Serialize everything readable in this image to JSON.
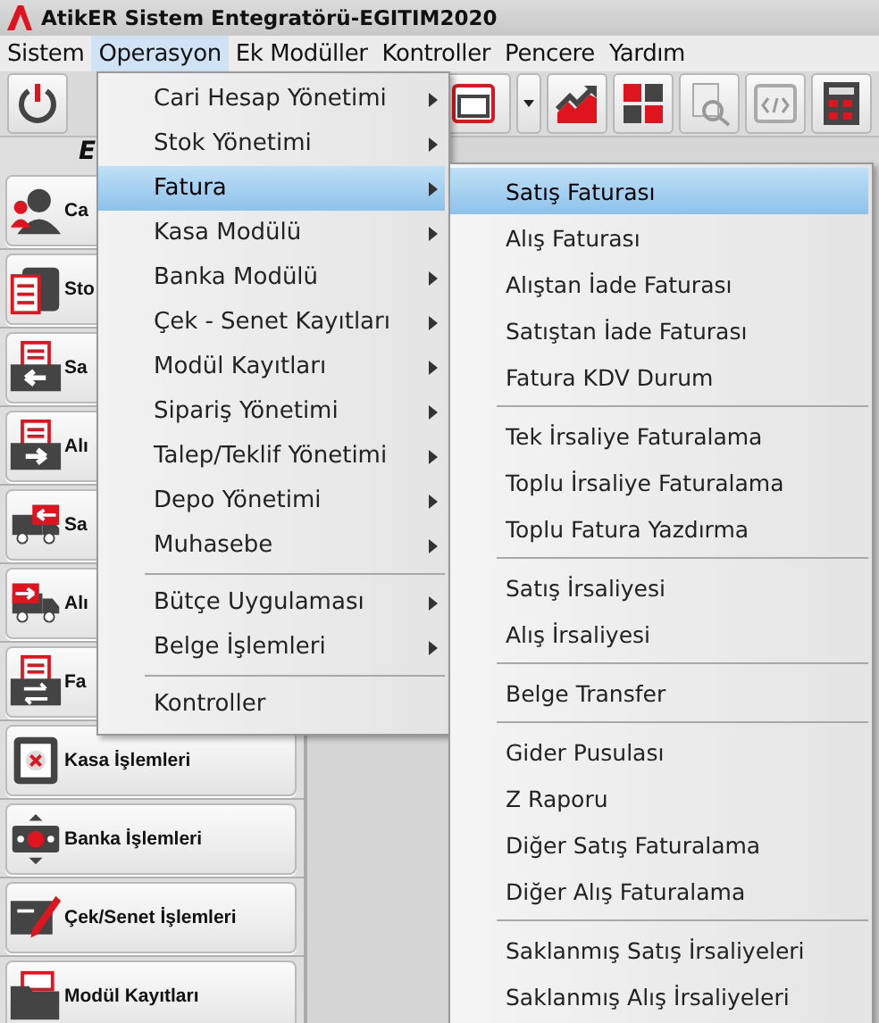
{
  "window": {
    "title": "AtikER Sistem Entegratörü-EGITIM2020"
  },
  "menubar": [
    {
      "label": "Sistem",
      "selected": false
    },
    {
      "label": "Operasyon",
      "selected": true
    },
    {
      "label": "Ek Modüller",
      "selected": false
    },
    {
      "label": "Kontroller",
      "selected": false
    },
    {
      "label": "Pencere",
      "selected": false
    },
    {
      "label": "Yardım",
      "selected": false
    }
  ],
  "toolbar_caption": "E",
  "sidebar_buttons": [
    {
      "label": "Ca"
    },
    {
      "label": "Sto"
    },
    {
      "label": "Sa"
    },
    {
      "label": "Alı"
    },
    {
      "label": "Sa"
    },
    {
      "label": "Alı"
    },
    {
      "label": "Fa"
    },
    {
      "label": "Kasa İşlemleri"
    },
    {
      "label": "Banka İşlemleri"
    },
    {
      "label": "Çek/Senet İşlemleri"
    },
    {
      "label": "Modül Kayıtları"
    }
  ],
  "menu": [
    {
      "kind": "item",
      "label": "Cari Hesap Yönetimi",
      "submenu": true,
      "selected": false
    },
    {
      "kind": "item",
      "label": "Stok Yönetimi",
      "submenu": true,
      "selected": false
    },
    {
      "kind": "item",
      "label": "Fatura",
      "submenu": true,
      "selected": true
    },
    {
      "kind": "item",
      "label": "Kasa Modülü",
      "submenu": true,
      "selected": false
    },
    {
      "kind": "item",
      "label": "Banka Modülü",
      "submenu": true,
      "selected": false
    },
    {
      "kind": "item",
      "label": "Çek - Senet Kayıtları",
      "submenu": true,
      "selected": false
    },
    {
      "kind": "item",
      "label": "Modül Kayıtları",
      "submenu": true,
      "selected": false
    },
    {
      "kind": "item",
      "label": "Sipariş Yönetimi",
      "submenu": true,
      "selected": false
    },
    {
      "kind": "item",
      "label": "Talep/Teklif Yönetimi",
      "submenu": true,
      "selected": false
    },
    {
      "kind": "item",
      "label": "Depo Yönetimi",
      "submenu": true,
      "selected": false
    },
    {
      "kind": "item",
      "label": "Muhasebe",
      "submenu": true,
      "selected": false
    },
    {
      "kind": "separator"
    },
    {
      "kind": "item",
      "label": "Bütçe Uygulaması",
      "submenu": true,
      "selected": false
    },
    {
      "kind": "item",
      "label": "Belge İşlemleri",
      "submenu": true,
      "selected": false
    },
    {
      "kind": "separator"
    },
    {
      "kind": "item",
      "label": "Kontroller",
      "submenu": false,
      "selected": false
    }
  ],
  "submenu": [
    {
      "kind": "item",
      "label": "Satış Faturası",
      "selected": true
    },
    {
      "kind": "item",
      "label": "Alış Faturası",
      "selected": false
    },
    {
      "kind": "item",
      "label": "Alıştan İade Faturası",
      "selected": false
    },
    {
      "kind": "item",
      "label": "Satıştan İade Faturası",
      "selected": false
    },
    {
      "kind": "item",
      "label": "Fatura KDV Durum",
      "selected": false
    },
    {
      "kind": "separator"
    },
    {
      "kind": "item",
      "label": "Tek İrsaliye Faturalama",
      "selected": false
    },
    {
      "kind": "item",
      "label": "Toplu İrsaliye Faturalama",
      "selected": false
    },
    {
      "kind": "item",
      "label": "Toplu Fatura Yazdırma",
      "selected": false
    },
    {
      "kind": "separator"
    },
    {
      "kind": "item",
      "label": "Satış İrsaliyesi",
      "selected": false
    },
    {
      "kind": "item",
      "label": "Alış İrsaliyesi",
      "selected": false
    },
    {
      "kind": "separator"
    },
    {
      "kind": "item",
      "label": "Belge Transfer",
      "selected": false
    },
    {
      "kind": "separator"
    },
    {
      "kind": "item",
      "label": "Gider Pusulası",
      "selected": false
    },
    {
      "kind": "item",
      "label": "Z Raporu",
      "selected": false
    },
    {
      "kind": "item",
      "label": "Diğer Satış Faturalama",
      "selected": false
    },
    {
      "kind": "item",
      "label": "Diğer Alış Faturalama",
      "selected": false
    },
    {
      "kind": "separator"
    },
    {
      "kind": "item",
      "label": "Saklanmış Satış İrsaliyeleri",
      "selected": false
    },
    {
      "kind": "item",
      "label": "Saklanmış Alış İrsaliyeleri",
      "selected": false
    }
  ]
}
